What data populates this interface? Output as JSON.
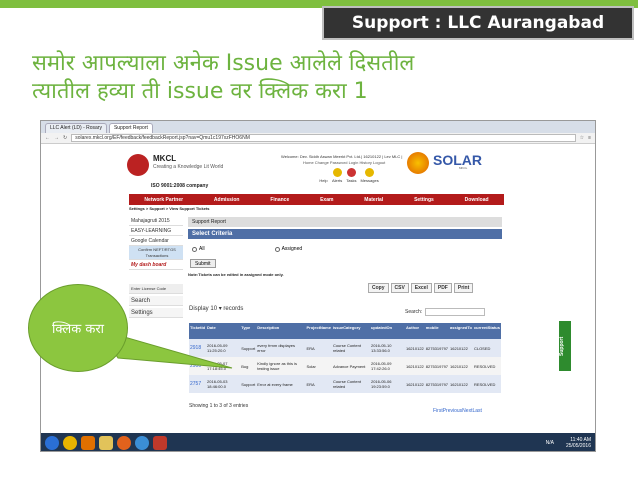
{
  "slide": {
    "title": "Support : LLC Aurangabad",
    "heading_line1": "समोर आपल्याला अनेक Issue आलेले दिसतील",
    "heading_line2": "त्यातील हव्या ती issue वर क्लिक करा 1",
    "callout_text": "क्लिक करा",
    "colors": {
      "accent_green": "#8cc63f",
      "heading_green": "#6db33f",
      "title_bg": "#333333"
    }
  },
  "browser": {
    "tabs": [
      "LLC Alert (LD) - Rosary",
      "Support Report"
    ],
    "address": "solarex.mkcl.org/EF/feedback/feedbackReport.jsp?nav=Qmu1c197xzFHO6NM"
  },
  "header": {
    "brand": "MKCL",
    "tagline": "Creating a Knowledge Lit World",
    "iso": "ISO 9001:2008 company",
    "welcome": "Welcome: Dev. Siddh Aswan Meerkt Pvt. Ltd.| 16210122 | Lev MLC |",
    "links": "Home  Change Password  Login History  Logout",
    "status_icons": [
      {
        "label": "Alerts",
        "icon": "alert-icon",
        "color": "#e6b800"
      },
      {
        "label": "Tasks",
        "icon": "task-icon",
        "color": "#cc3333"
      },
      {
        "label": "Messages",
        "icon": "message-icon",
        "color": "#e6b800"
      }
    ],
    "help": "Help",
    "solar_brand": "SOLAR",
    "solar_tag": "MKCL"
  },
  "nav": {
    "items": [
      "Network Partner",
      "Admission",
      "Finance",
      "Exam",
      "Material",
      "Settings",
      "Download"
    ]
  },
  "breadcrumb": "Settings >   Support >   View Support Tickets",
  "sidebar": {
    "items": [
      "Mahajagruti 2015",
      "EASY-LEARNING",
      "Google Calendar"
    ],
    "blue_item": "Confirm NEFT/RTGS Transactions",
    "dashboard": "My dash board",
    "license": "Enter License Code",
    "search": "Search",
    "settings": "Settings"
  },
  "report": {
    "title": "Support Report",
    "criteria": "Select Criteria",
    "radio_all": "All",
    "radio_assigned": "Assigned",
    "submit": "Submit",
    "note": "Note:Tickets can be edited in assigned mode only.",
    "export": [
      "Copy",
      "CSV",
      "Excel",
      "PDF",
      "Print"
    ],
    "display_label": "Display",
    "display_value": "10",
    "display_suffix": "records",
    "search_label": "Search:",
    "columns": [
      "TicketId",
      "Date",
      "Type",
      "Description",
      "ProjectName",
      "issueCategory",
      "updatedOn",
      "Author",
      "mobile",
      "assignedTo",
      "currentStatus"
    ],
    "rows": [
      [
        "2918",
        "2016-05-09 11:25:20.0",
        "Support",
        "every frmm displayes error",
        "ERA",
        "Course Content related",
        "2016-05-10 13:33:56.0",
        "16210122",
        "8275319797",
        "16210122",
        "CLOSED"
      ],
      [
        "2900",
        "2016-05-07 17:18:45.0",
        "Bug",
        "Kindly ignore as this is testing issue",
        "Solar",
        "Advance Payment",
        "2016-05-09 17:42:26.0",
        "16210122",
        "8275319797",
        "16210122",
        "RESOLVED"
      ],
      [
        "2757",
        "2016-05-03 18:46:00.0",
        "Support",
        "Error at every frame",
        "ERA",
        "Course Content related",
        "2016-05-06 19:23:59.0",
        "16210122",
        "8275319797",
        "16210122",
        "RESOLVED"
      ]
    ],
    "showing": "Showing 1 to 3 of 3 entries",
    "pager": "FirstPreviousNextLast",
    "support_tab": "Support"
  },
  "taskbar": {
    "na": "N/A",
    "time": "11:40 AM",
    "date": "25/05/2016"
  }
}
